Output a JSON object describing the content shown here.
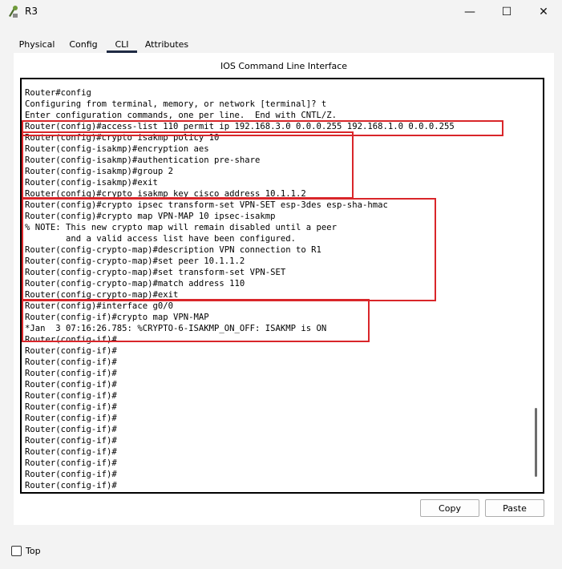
{
  "window": {
    "title": "R3",
    "controls": {
      "minimize": "—",
      "maximize": "☐",
      "close": "✕"
    }
  },
  "tabs": [
    {
      "label": "Physical",
      "active": false
    },
    {
      "label": "Config",
      "active": false
    },
    {
      "label": "CLI",
      "active": true
    },
    {
      "label": "Attributes",
      "active": false
    }
  ],
  "panel": {
    "title": "IOS Command Line Interface"
  },
  "terminal": {
    "lines": [
      "Router#config",
      "Configuring from terminal, memory, or network [terminal]? t",
      "Enter configuration commands, one per line.  End with CNTL/Z.",
      "Router(config)#access-list 110 permit ip 192.168.3.0 0.0.0.255 192.168.1.0 0.0.0.255",
      "Router(config)#crypto isakmp policy 10",
      "Router(config-isakmp)#encryption aes",
      "Router(config-isakmp)#authentication pre-share",
      "Router(config-isakmp)#group 2",
      "Router(config-isakmp)#exit",
      "Router(config)#crypto isakmp key cisco address 10.1.1.2",
      "Router(config)#crypto ipsec transform-set VPN-SET esp-3des esp-sha-hmac",
      "Router(config)#crypto map VPN-MAP 10 ipsec-isakmp",
      "% NOTE: This new crypto map will remain disabled until a peer",
      "        and a valid access list have been configured.",
      "Router(config-crypto-map)#description VPN connection to R1",
      "Router(config-crypto-map)#set peer 10.1.1.2",
      "Router(config-crypto-map)#set transform-set VPN-SET",
      "Router(config-crypto-map)#match address 110",
      "Router(config-crypto-map)#exit",
      "Router(config)#interface g0/0",
      "Router(config-if)#crypto map VPN-MAP",
      "*Jan  3 07:16:26.785: %CRYPTO-6-ISAKMP_ON_OFF: ISAKMP is ON",
      "Router(config-if)#",
      "Router(config-if)#",
      "Router(config-if)#",
      "Router(config-if)#",
      "Router(config-if)#",
      "Router(config-if)#",
      "Router(config-if)#",
      "Router(config-if)#",
      "Router(config-if)#",
      "Router(config-if)#",
      "Router(config-if)#",
      "Router(config-if)#",
      "Router(config-if)#",
      "Router(config-if)#"
    ]
  },
  "buttons": {
    "copy": "Copy",
    "paste": "Paste"
  },
  "footer": {
    "top_label": "Top",
    "top_checked": false
  },
  "colors": {
    "highlight": "#d9262a",
    "tab_underline": "#1f2a44"
  }
}
